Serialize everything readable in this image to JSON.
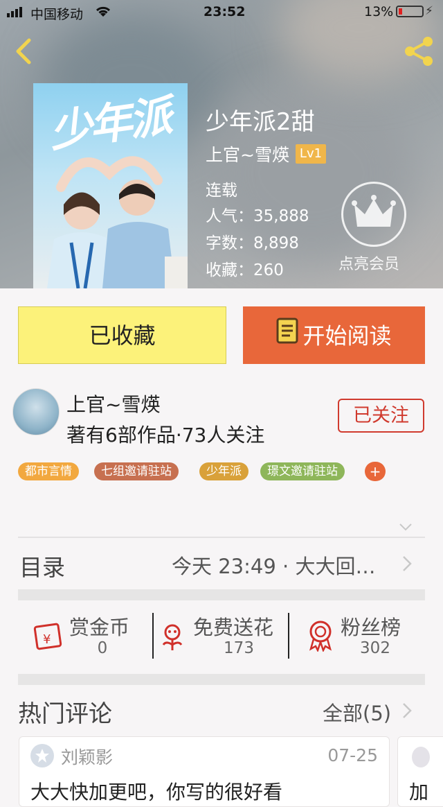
{
  "status_bar": {
    "carrier": "中国移动",
    "time": "23:52",
    "battery": "13%"
  },
  "book": {
    "title": "少年派2甜",
    "author": "上官~雪煐",
    "level": "Lv1",
    "status": "连载",
    "popularity": "人气：35,888",
    "word_count": "字数：8,898",
    "favorites": "收藏：260",
    "cover_title": "少年派"
  },
  "vip": {
    "label": "点亮会员"
  },
  "actions": {
    "favorited_label": "已收藏",
    "read_label": "开始阅读"
  },
  "author_card": {
    "name": "上官~雪煐",
    "summary": "著有6部作品·73人关注",
    "follow_label": "已关注"
  },
  "tags": [
    {
      "label": "都市言情",
      "color": "#f2a83f"
    },
    {
      "label": "七组邀请驻站",
      "color": "#c77050"
    },
    {
      "label": "少年派",
      "color": "#d9a13a"
    },
    {
      "label": "璟文邀请驻站",
      "color": "#8eb65a"
    }
  ],
  "tag_more": "+",
  "catalog": {
    "label": "目录",
    "latest": "今天 23:49 · 大大回…"
  },
  "stats": [
    {
      "label": "赏金币",
      "value": "0",
      "icon": "red-envelope-icon"
    },
    {
      "label": "免费送花",
      "value": "173",
      "icon": "flower-icon"
    },
    {
      "label": "粉丝榜",
      "value": "302",
      "icon": "medal-icon"
    }
  ],
  "comments": {
    "heading": "热门评论",
    "all_label": "全部(5)",
    "items": [
      {
        "user": "刘颖影",
        "date": "07-25",
        "text": "大大快加更吧，你写的很好看"
      }
    ],
    "next_peek": "加"
  },
  "colors": {
    "accent_orange": "#e8673a",
    "fav_yellow": "#fcf27a",
    "red": "#d03a2e"
  }
}
